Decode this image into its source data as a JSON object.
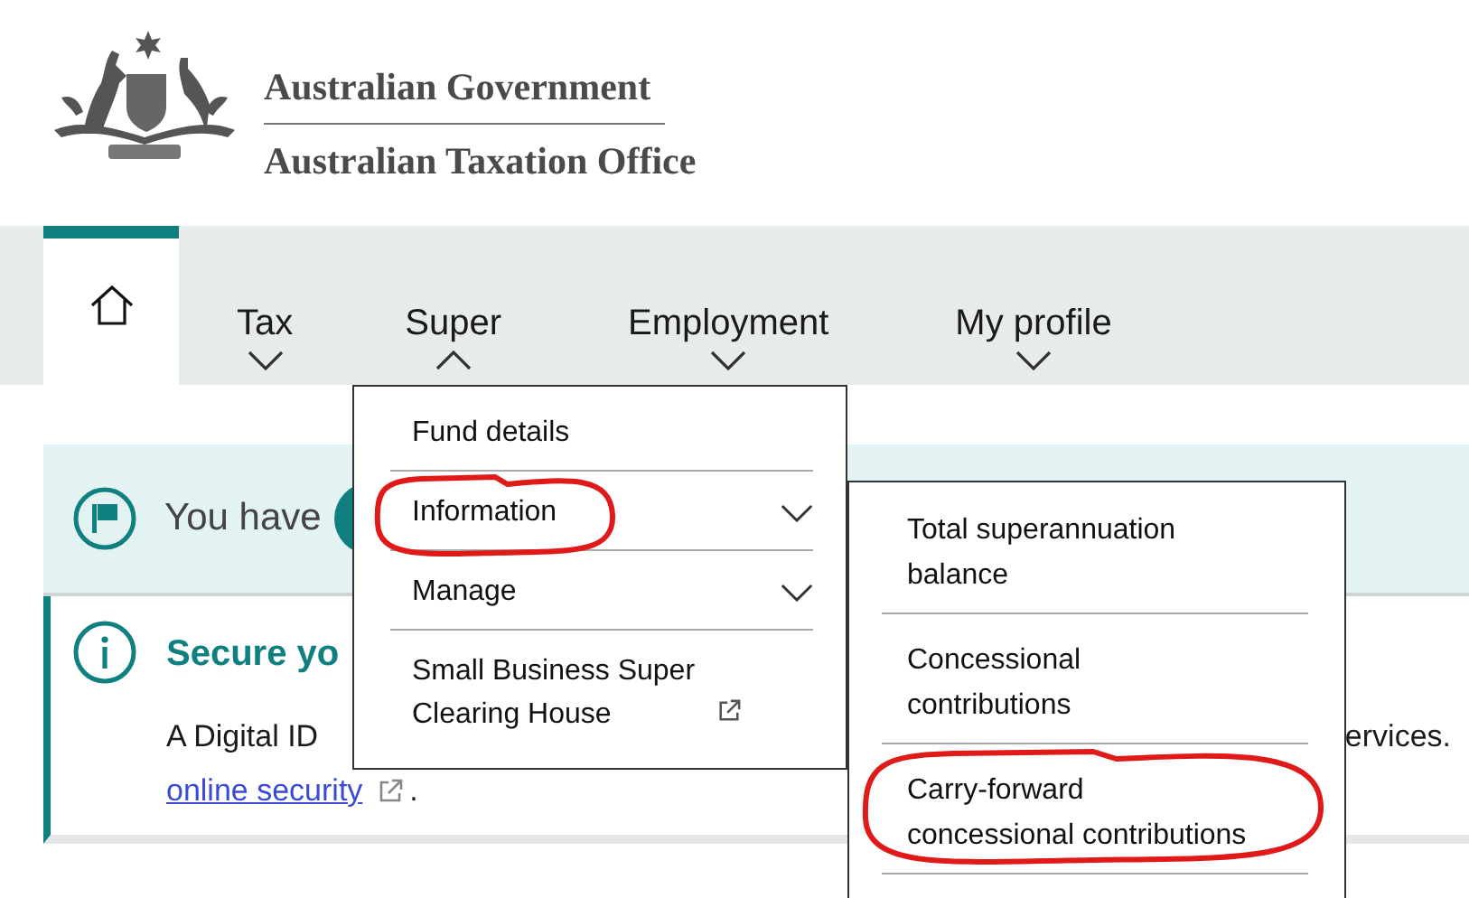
{
  "header": {
    "government": "Australian Government",
    "agency": "Australian Taxation Office"
  },
  "nav": {
    "items": [
      {
        "kind": "home",
        "selected": true
      },
      {
        "kind": "menu",
        "label": "Tax",
        "selected": false,
        "expanded": false
      },
      {
        "kind": "menu",
        "label": "Super",
        "selected": false,
        "expanded": true
      },
      {
        "kind": "menu",
        "label": "Employment",
        "selected": false,
        "expanded": false
      },
      {
        "kind": "menu",
        "label": "My profile",
        "selected": false,
        "expanded": false
      }
    ]
  },
  "menu": {
    "items": [
      {
        "kind": "link",
        "label": "Fund details",
        "circled": false
      },
      {
        "kind": "submenu",
        "label": "Information",
        "circled": true
      },
      {
        "kind": "submenu",
        "label": "Manage",
        "circled": false
      },
      {
        "kind": "external",
        "label": "Small Business Super\nClearing House",
        "circled": false
      }
    ]
  },
  "submenu": {
    "items": [
      {
        "label": "Total superannuation\nbalance",
        "circled": false
      },
      {
        "label": "Concessional\ncontributions",
        "circled": false
      },
      {
        "label": "Carry-forward\nconcessional contributions",
        "circled": true
      }
    ]
  },
  "banner": {
    "text": "You have"
  },
  "alert": {
    "title": "Secure yo",
    "body_start": "A Digital ID",
    "body_end": "ervices.",
    "link": "online security",
    "after_link": "."
  }
}
